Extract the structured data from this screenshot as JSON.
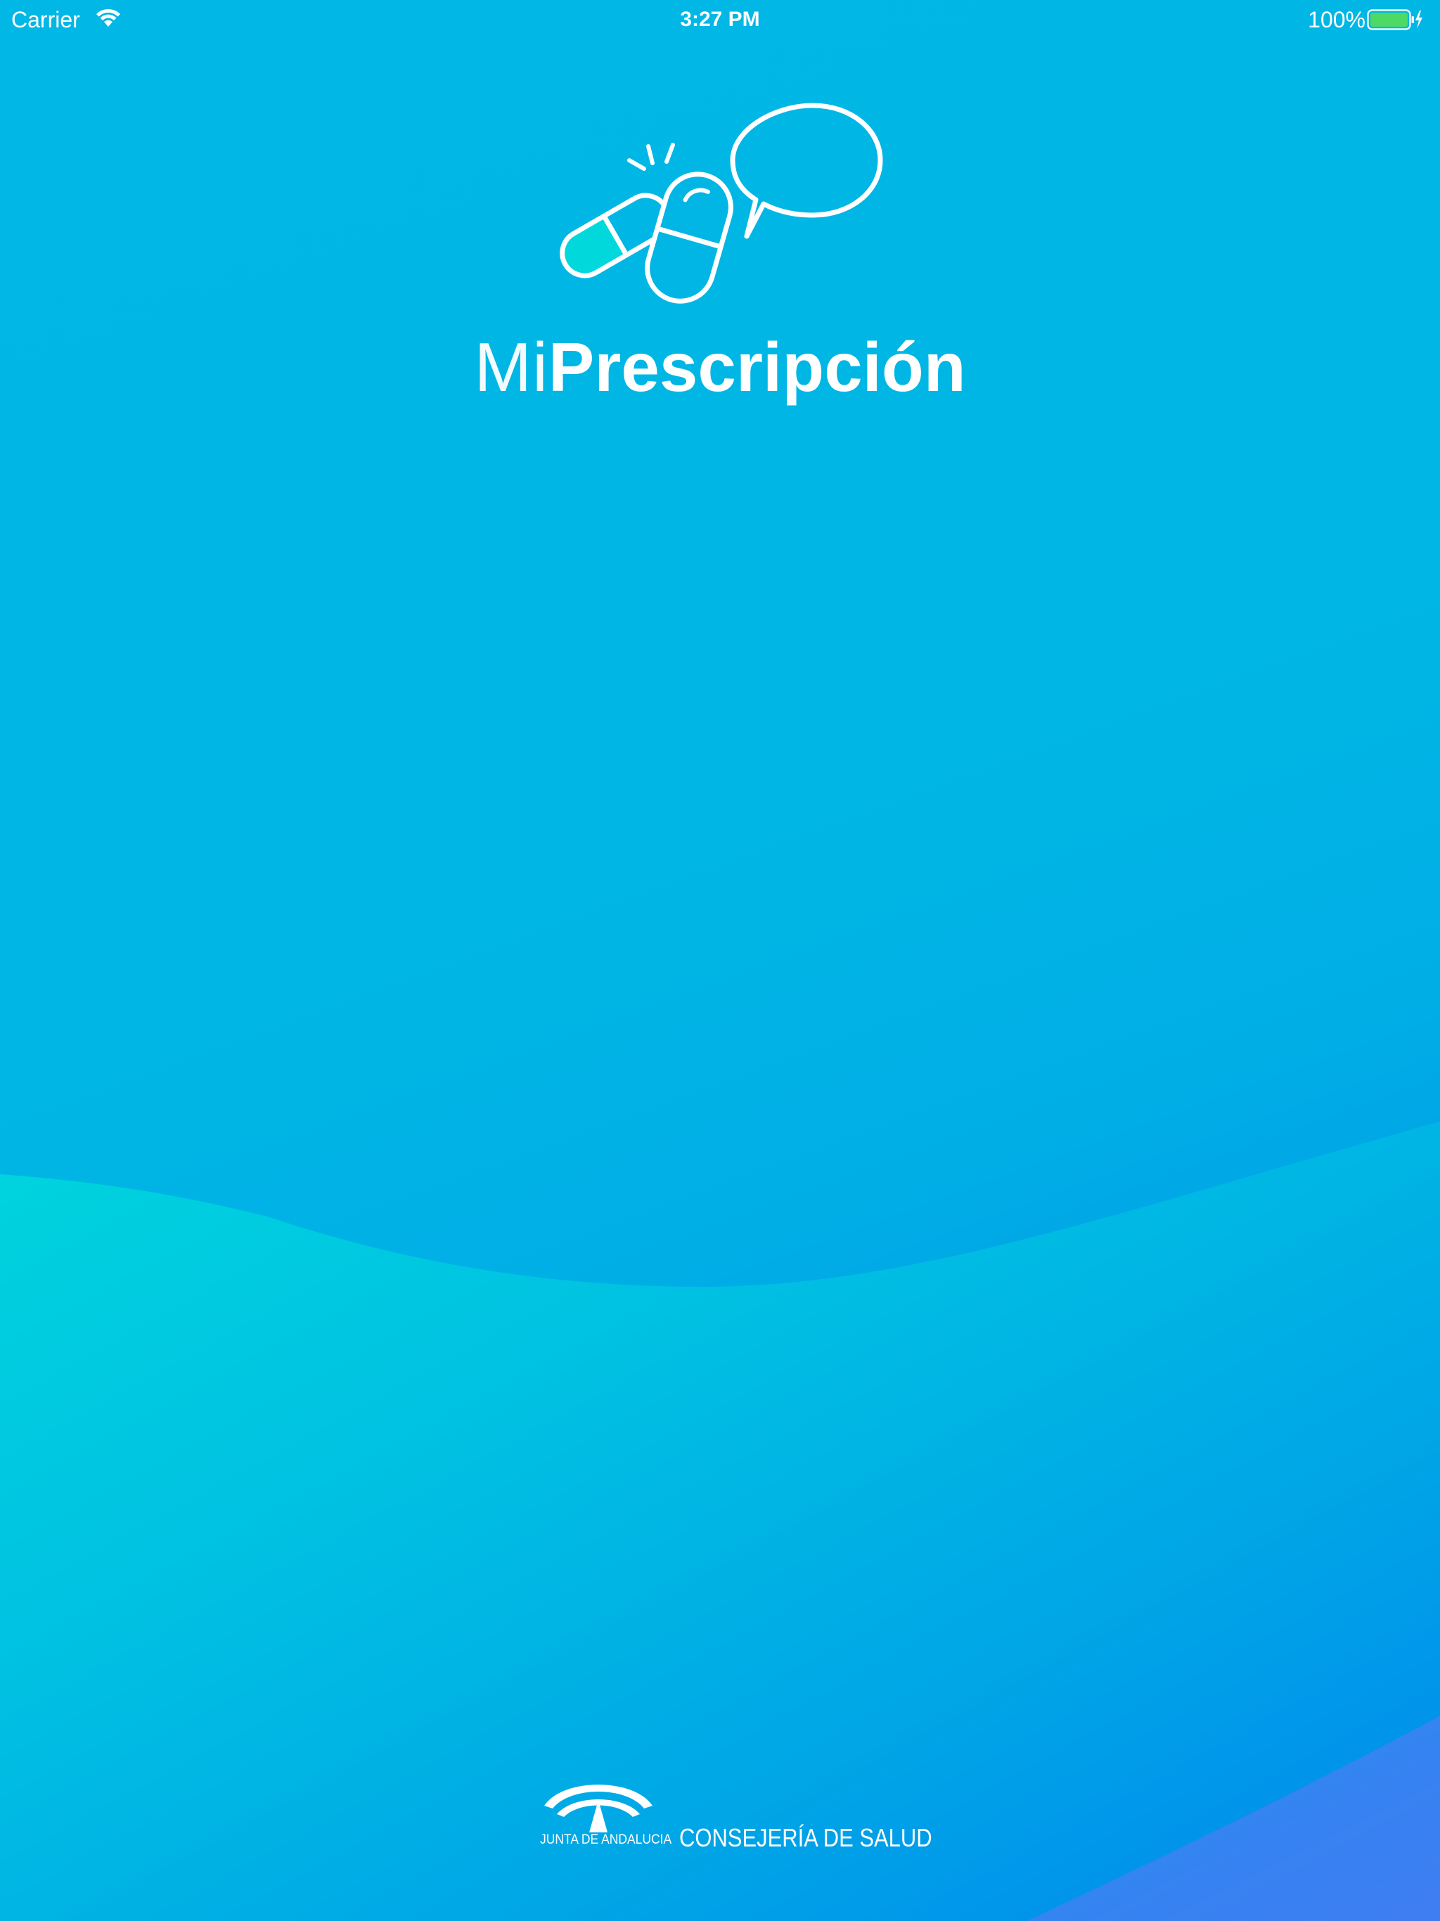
{
  "status_bar": {
    "carrier": "Carrier",
    "time": "3:27 PM",
    "battery_percent": "100%",
    "wifi_icon": "wifi-icon",
    "battery_icon": "battery-charging-icon"
  },
  "app": {
    "logo_icon": "pills-speech-bubble-icon",
    "title_light": "Mi",
    "title_bold": "Prescripción"
  },
  "footer": {
    "emblem_icon": "junta-andalucia-emblem-icon",
    "junta_text": "JUNTA DE ANDALUCIA",
    "department": "CONSEJERÍA DE SALUD"
  },
  "colors": {
    "background_top": "#01b6e4",
    "background_bottom": "#0183f1",
    "wave_accent": "#00d6dd",
    "battery_fill": "#4cd964",
    "pill_fill": "#00d8dc",
    "foreground": "#ffffff"
  }
}
